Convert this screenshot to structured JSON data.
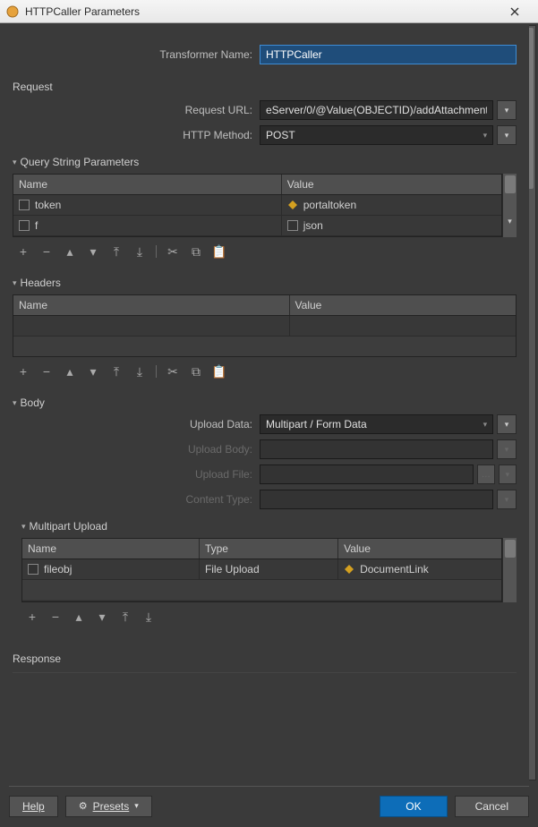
{
  "window": {
    "title": "HTTPCaller Parameters"
  },
  "transformer": {
    "label": "Transformer Name:",
    "value": "HTTPCaller"
  },
  "sections": {
    "request": "Request",
    "query": "Query String Parameters",
    "headers": "Headers",
    "body": "Body",
    "multipart": "Multipart Upload",
    "response": "Response"
  },
  "request": {
    "url_label": "Request URL:",
    "url_value": "eServer/0/@Value(OBJECTID)/addAttachment",
    "method_label": "HTTP Method:",
    "method_value": "POST"
  },
  "query_table": {
    "headers": [
      "Name",
      "Value"
    ],
    "rows": [
      {
        "name": "token",
        "value": "portaltoken",
        "value_icon": "param"
      },
      {
        "name": "f",
        "value": "json",
        "value_icon": "attr"
      }
    ]
  },
  "headers_table": {
    "headers": [
      "Name",
      "Value"
    ],
    "rows": []
  },
  "body": {
    "upload_data_label": "Upload Data:",
    "upload_data_value": "Multipart / Form Data",
    "upload_body_label": "Upload Body:",
    "upload_body_value": "",
    "upload_file_label": "Upload File:",
    "upload_file_value": "",
    "content_type_label": "Content Type:",
    "content_type_value": ""
  },
  "multipart_table": {
    "headers": [
      "Name",
      "Type",
      "Value"
    ],
    "rows": [
      {
        "name": "fileobj",
        "type": "File Upload",
        "value": "DocumentLink",
        "value_icon": "param"
      }
    ]
  },
  "toolbar_icons": {
    "add": "+",
    "remove": "−",
    "up": "▴",
    "down": "▾",
    "top": "⤒",
    "bottom": "⤓",
    "cut": "✂",
    "copy": "⧉",
    "paste": "📋"
  },
  "buttons": {
    "help": "Help",
    "presets": "Presets",
    "ok": "OK",
    "cancel": "Cancel"
  }
}
